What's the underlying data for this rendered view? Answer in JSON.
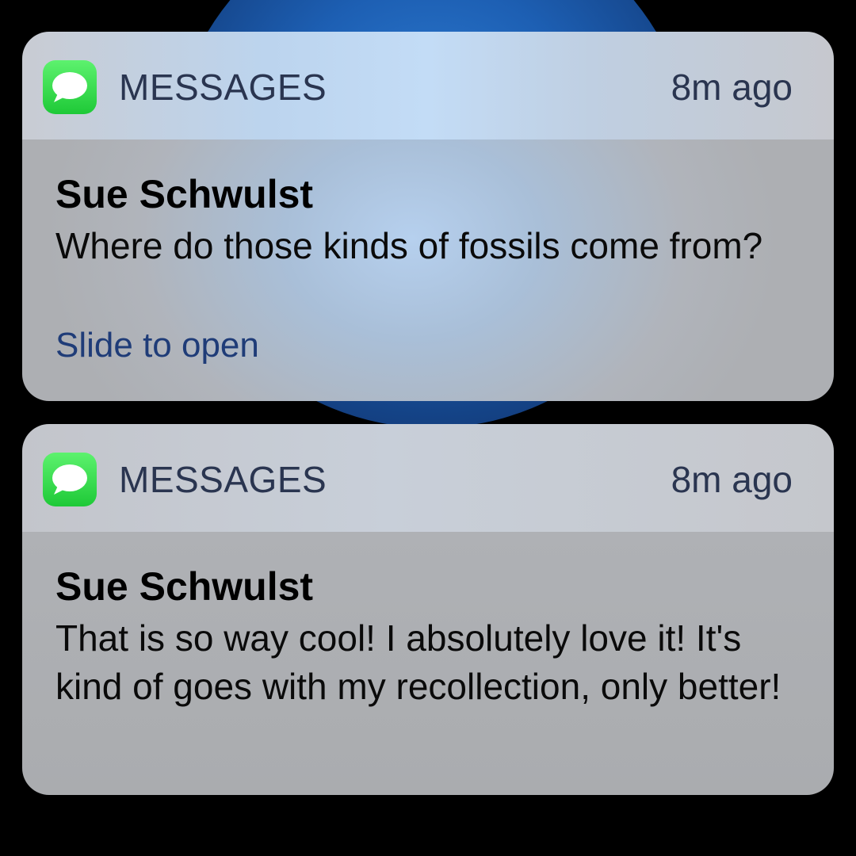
{
  "notifications": [
    {
      "app_icon": "messages-icon",
      "app_name": "MESSAGES",
      "time": "8m ago",
      "sender": "Sue Schwulst",
      "message": "Where do those kinds of fossils come from?",
      "action_hint": "Slide to open"
    },
    {
      "app_icon": "messages-icon",
      "app_name": "MESSAGES",
      "time": "8m ago",
      "sender": "Sue Schwulst",
      "message": "That is so way cool! I absolutely love it! It's kind of goes with my recollection, only better!"
    }
  ],
  "colors": {
    "messages_green": "#34d34b",
    "header_text": "#2a3550",
    "hint_text": "#1f3c78",
    "wallpaper_blue": "#1d5fb3"
  }
}
